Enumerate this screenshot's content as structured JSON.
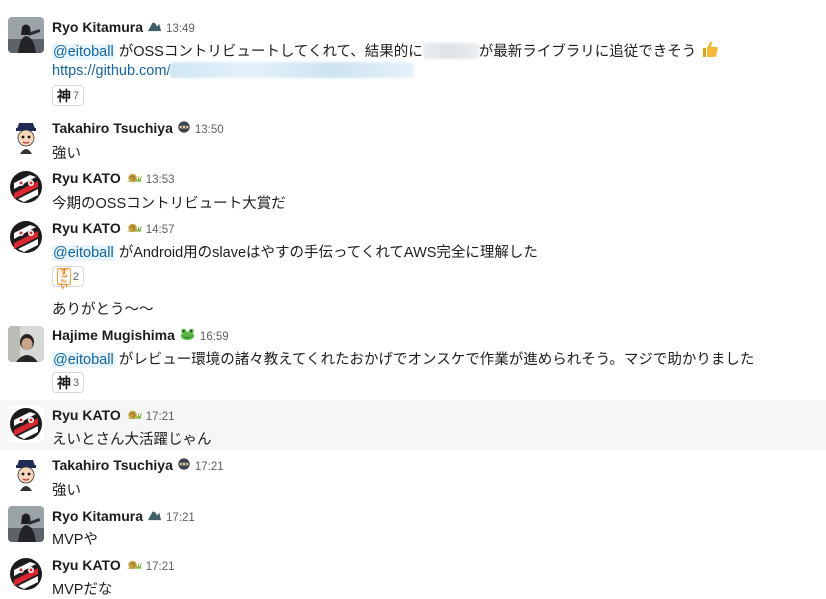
{
  "messages": [
    {
      "user": "Ryo Kitamura",
      "status_icon": "mountain-icon",
      "time": "13:49",
      "lines": [
        {
          "mention": "@eitoball",
          "before": " がOSSコントリビュートしてくれて、結果的に",
          "after": "が最新ライブラリに追従できそう"
        },
        {
          "link": "https://github.com/"
        }
      ],
      "emoji": "thumbs-up-icon",
      "reaction": {
        "label": "神",
        "count": "7"
      }
    },
    {
      "user": "Takahiro Tsuchiya",
      "status_icon": "ninja-icon",
      "time": "13:50",
      "text": "強い"
    },
    {
      "user": "Ryu KATO",
      "status_icon": "snail-icon",
      "time": "13:53",
      "text": "今期のOSSコントリビュート大賞だ"
    },
    {
      "user": "Ryu KATO",
      "status_icon": "snail-icon",
      "time": "14:57",
      "mention": "@eitoball",
      "text": " がAndroid用のslaveはやすの手伝ってくれてAWS完全に理解した",
      "reaction": {
        "label": "すごい",
        "count": "2"
      },
      "followup": "ありがとう〜〜"
    },
    {
      "user": "Hajime Mugishima",
      "status_icon": "frog-icon",
      "time": "16:59",
      "mention": "@eitoball",
      "text": " がレビュー環境の諸々教えてくれたおかげでオンスケで作業が進められそう。マジで助かりました",
      "reaction": {
        "label": "神",
        "count": "3"
      }
    },
    {
      "user": "Ryu KATO",
      "status_icon": "snail-icon",
      "time": "17:21",
      "text": "えいとさん大活躍じゃん"
    },
    {
      "user": "Takahiro Tsuchiya",
      "status_icon": "ninja-icon",
      "time": "17:21",
      "text": "強い"
    },
    {
      "user": "Ryo Kitamura",
      "status_icon": "mountain-icon",
      "time": "17:21",
      "text": "MVPや"
    },
    {
      "user": "Ryu KATO",
      "status_icon": "snail-icon",
      "time": "17:21",
      "text": "MVPだな"
    }
  ],
  "colors": {
    "mention": "#1264a3",
    "mention_bg": "#e8f5fa",
    "highlight_row": "#f6f6f6"
  }
}
